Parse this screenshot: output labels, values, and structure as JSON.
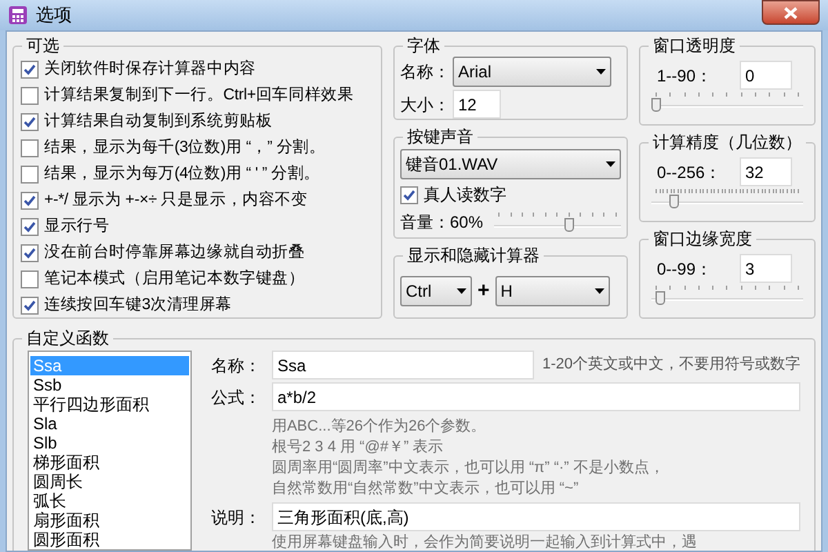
{
  "window": {
    "title": "选项"
  },
  "options_group": {
    "title": "可选",
    "items": [
      {
        "label": "关闭软件时保存计算器中内容",
        "checked": true
      },
      {
        "label": "计算结果复制到下一行。Ctrl+回车同样效果",
        "checked": false
      },
      {
        "label": "计算结果自动复制到系统剪贴板",
        "checked": true
      },
      {
        "label": "结果，显示为每千(3位数)用 “，” 分割。",
        "checked": false
      },
      {
        "label": "结果，显示为每万(4位数)用 “ ' ” 分割。",
        "checked": false
      },
      {
        "label": "+-*/  显示为  +-×÷ 只是显示，内容不变",
        "checked": true
      },
      {
        "label": "显示行号",
        "checked": true
      },
      {
        "label": "没在前台时停靠屏幕边缘就自动折叠",
        "checked": true
      },
      {
        "label": "笔记本模式（启用笔记本数字键盘）",
        "checked": false
      },
      {
        "label": "连续按回车键3次清理屏幕",
        "checked": true
      }
    ]
  },
  "font_group": {
    "title": "字体",
    "name_label": "名称：",
    "name_value": "Arial",
    "size_label": "大小：",
    "size_value": "12"
  },
  "sound_group": {
    "title": "按键声音",
    "sound_value": "键音01.WAV",
    "read_digits": {
      "label": "真人读数字",
      "checked": true
    },
    "volume_label": "音量：60%",
    "volume": {
      "level": 0.6
    }
  },
  "hotkey_group": {
    "title": "显示和隐藏计算器",
    "modifier": "Ctrl",
    "plus": "+",
    "key": "H"
  },
  "transparency_group": {
    "title": "窗口透明度",
    "range_label": "1--90：",
    "value": "0",
    "slider": {
      "level": 0
    }
  },
  "precision_group": {
    "title": "计算精度（几位数）",
    "range_label": "0--256：",
    "value": "32",
    "slider": {
      "level": 0.125
    }
  },
  "edge_group": {
    "title": "窗口边缘宽度",
    "range_label": "0--99：",
    "value": "3",
    "slider": {
      "level": 0.03
    }
  },
  "functions_group": {
    "title": "自定义函数",
    "list": [
      {
        "label": "Ssa",
        "selected": true
      },
      {
        "label": "Ssb",
        "selected": false
      },
      {
        "label": "平行四边形面积",
        "selected": false
      },
      {
        "label": "Sla",
        "selected": false
      },
      {
        "label": "Slb",
        "selected": false
      },
      {
        "label": "梯形面积",
        "selected": false
      },
      {
        "label": "圆周长",
        "selected": false
      },
      {
        "label": "弧长",
        "selected": false
      },
      {
        "label": "扇形面积",
        "selected": false
      },
      {
        "label": "圆形面积",
        "selected": false
      }
    ],
    "name_label": "名称：",
    "name_value": "Ssa",
    "name_hint": "1-20个英文或中文，不要用符号或数字",
    "formula_label": "公式：",
    "formula_value": "a*b/2",
    "formula_help": [
      "用ABC...等26个作为26个参数。",
      "根号2 3 4 用 “@#￥” 表示",
      "圆周率用“圆周率”中文表示，也可以用 “π”  “·” 不是小数点，",
      "自然常数用“自然常数”中文表示，也可以用 “~”"
    ],
    "desc_label": "说明：",
    "desc_value": "三角形面积(底,高)",
    "desc_help": "使用屏幕键盘输入时，会作为简要说明一起输入到计算式中，遇"
  }
}
